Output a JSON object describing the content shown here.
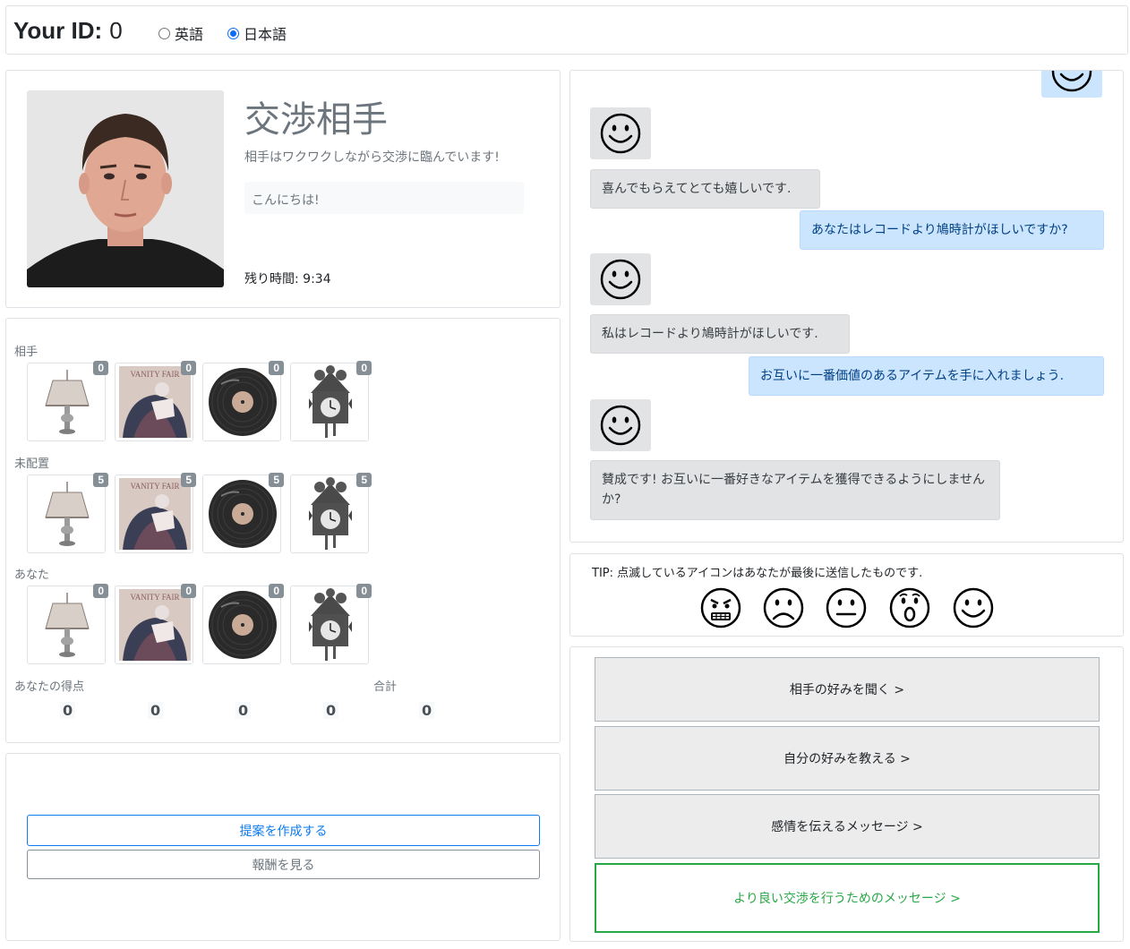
{
  "header": {
    "id_label": "Your ID:",
    "id_value": "0",
    "lang_options": [
      {
        "label": "英語",
        "selected": false
      },
      {
        "label": "日本語",
        "selected": true
      }
    ]
  },
  "opponent": {
    "title": "交渉相手",
    "status": "相手はワクワクしながら交渉に臨んでいます!",
    "message": "こんにちは!",
    "timer": "残り時間: 9:34"
  },
  "items": {
    "rows": [
      {
        "label": "相手",
        "counts": [
          "0",
          "0",
          "0",
          "0"
        ]
      },
      {
        "label": "未配置",
        "counts": [
          "5",
          "5",
          "5",
          "5"
        ]
      },
      {
        "label": "あなた",
        "counts": [
          "0",
          "0",
          "0",
          "0"
        ]
      }
    ],
    "item_names": [
      "lamp-icon",
      "painting-icon",
      "record-icon",
      "cuckoo-clock-icon"
    ],
    "score_label": "あなたの得点",
    "total_label": "合計",
    "scores": [
      "0",
      "0",
      "0",
      "0"
    ],
    "total": "0"
  },
  "offer": {
    "create_label": "提案を作成する",
    "reward_label": "報酬を見る"
  },
  "chat": {
    "messages": [
      {
        "from": "them",
        "text": "喜んでもらえてとても嬉しいです."
      },
      {
        "from": "me",
        "text": "あなたはレコードより鳩時計がほしいですか?"
      },
      {
        "from": "them",
        "text": "私はレコードより鳩時計がほしいです."
      },
      {
        "from": "me",
        "text": "お互いに一番価値のあるアイテムを手に入れましょう."
      },
      {
        "from": "them",
        "text": "賛成です! お互いに一番好きなアイテムを獲得できるようにしませんか?"
      }
    ]
  },
  "emotions": {
    "tip": "TIP: 点滅しているアイコンはあなたが最後に送信したものです.",
    "icons": [
      "angry-face-icon",
      "sad-face-icon",
      "neutral-face-icon",
      "surprised-face-icon",
      "happy-face-icon"
    ]
  },
  "actions": [
    {
      "label": "相手の好みを聞く >"
    },
    {
      "label": "自分の好みを教える >"
    },
    {
      "label": "感情を伝えるメッセージ >"
    },
    {
      "label": "より良い交渉を行うためのメッセージ >"
    }
  ],
  "colors": {
    "primary": "#0d7bf2",
    "success": "#28a745",
    "badge": "#868e96",
    "chat_me_bg": "#cce5ff",
    "chat_them_bg": "#e2e3e5"
  }
}
